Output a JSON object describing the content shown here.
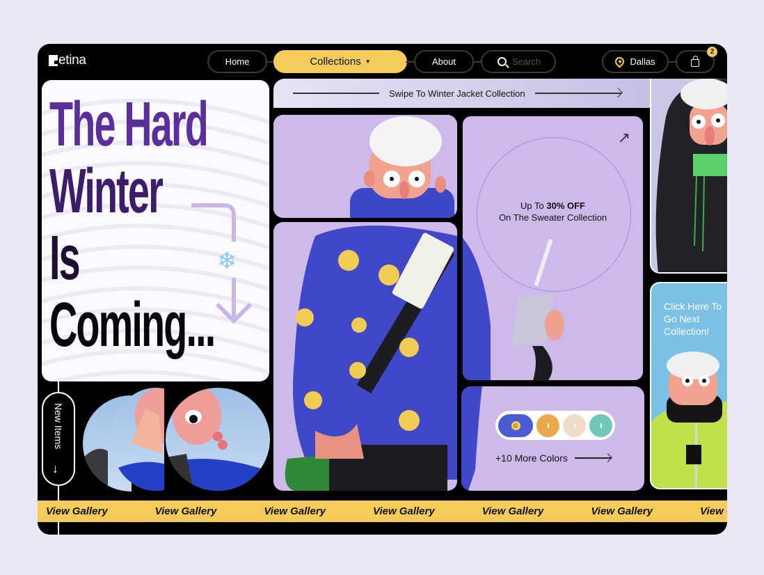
{
  "brand": {
    "name": "etina",
    "full_name": "Retina"
  },
  "nav": {
    "items": [
      {
        "label": "Home"
      },
      {
        "label": "Collections",
        "active": true,
        "has_dropdown": true
      },
      {
        "label": "About"
      }
    ],
    "search_placeholder": "Search",
    "location": "Dallas",
    "cart_count": "2"
  },
  "hero": {
    "headline_lines": [
      "The Hard",
      "Winter",
      "Is",
      "Coming..."
    ],
    "decoration_icon": "snowflake-icon",
    "snowflake_glyph": "❄"
  },
  "swipe_bar": {
    "label": "Swipe To Winter Jacket Collection"
  },
  "offer_card": {
    "line1_prefix": "Up To ",
    "line1_bold": "30% OFF",
    "line2": "On The Sweater Collection",
    "arrow_glyph": "↗"
  },
  "colors_card": {
    "swatches": [
      {
        "name": "blue",
        "color": "#4a5bd4",
        "selected": true
      },
      {
        "name": "orange",
        "color": "#eaa94a"
      },
      {
        "name": "beige",
        "color": "#efdcc9"
      },
      {
        "name": "teal",
        "color": "#72c8b6"
      }
    ],
    "more_label": "+10 More Colors",
    "smile_glyph": "☺"
  },
  "next_card": {
    "text": "Click Here To Go Next Collection!"
  },
  "new_items": {
    "label": "New Items",
    "arrow_glyph": "↓"
  },
  "marquee": {
    "items": [
      "View Gallery",
      "View Gallery",
      "View Gallery",
      "View Gallery",
      "View Gallery",
      "View Gallery",
      "View Gallery"
    ]
  },
  "colors": {
    "accent": "#f5cb5c",
    "frame": "#000000",
    "card_lavender": "#cdb9ea",
    "card_sky": "#7bc1e3",
    "headline_purple": "#5a2f9a",
    "page_bg": "#ebe8f6"
  }
}
